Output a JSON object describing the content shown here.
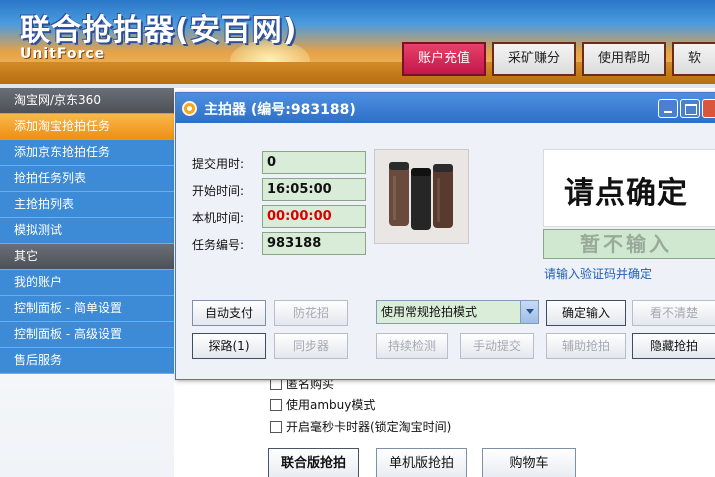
{
  "header": {
    "brand": "联合抢拍器(安百网)",
    "brand_sub": "UnitForce",
    "tabs": [
      {
        "label": "账户充值",
        "active": true
      },
      {
        "label": "采矿赚分",
        "active": false
      },
      {
        "label": "使用帮助",
        "active": false
      },
      {
        "label": "软",
        "active": false
      }
    ]
  },
  "sidebar": {
    "items": [
      {
        "label": "淘宝网/京东360",
        "kind": "head"
      },
      {
        "label": "添加淘宝抢拍任务",
        "kind": "sel"
      },
      {
        "label": "添加京东抢拍任务",
        "kind": "blue"
      },
      {
        "label": "抢拍任务列表",
        "kind": "blue"
      },
      {
        "label": "主抢拍列表",
        "kind": "blue"
      },
      {
        "label": "模拟测试",
        "kind": "blue"
      },
      {
        "label": "其它",
        "kind": "head"
      },
      {
        "label": "我的账户",
        "kind": "blue"
      },
      {
        "label": "控制面板 - 简单设置",
        "kind": "blue"
      },
      {
        "label": "控制面板 - 高级设置",
        "kind": "blue"
      },
      {
        "label": "售后服务",
        "kind": "blue"
      }
    ]
  },
  "background": {
    "options": [
      {
        "label": "匿名购买"
      },
      {
        "label": "使用ambuy模式"
      },
      {
        "label": "开启毫秒卡时器(锁定淘宝时间)"
      }
    ],
    "buttons": [
      {
        "label": "联合版抢拍"
      },
      {
        "label": "单机版抢拍"
      },
      {
        "label": "购物车"
      }
    ]
  },
  "window": {
    "title": "主拍器",
    "code": "(编号:983188)",
    "fields": [
      {
        "label": "提交用时:",
        "value": "0",
        "red": false
      },
      {
        "label": "开始时间:",
        "value": "16:05:00",
        "red": false
      },
      {
        "label": "本机时间:",
        "value": "00:00:00",
        "red": true
      },
      {
        "label": "任务编号:",
        "value": "983188",
        "red": false
      }
    ],
    "captcha": {
      "image_text": "请点确定",
      "input_placeholder": "暂不输入",
      "hint": "请输入验证码并确定"
    },
    "mode_select": "使用常规抢拍模式",
    "buttons": {
      "auto_pay": "自动支付",
      "prevent_trick": "防花招",
      "confirm_input": "确定输入",
      "cant_see": "看不清楚",
      "probe": "探路(1)",
      "sync": "同步器",
      "continuous": "持续检测",
      "manual_submit": "手动提交",
      "assist": "辅助抢拍",
      "hide": "隐藏抢拍"
    }
  },
  "colors": {
    "sidebar_blue": "#3d8ad6",
    "sidebar_selected": "#f2a02a",
    "tab_active": "#d22a58",
    "field_green": "#d8ecd8",
    "title_blue": "#3a7bd0"
  }
}
